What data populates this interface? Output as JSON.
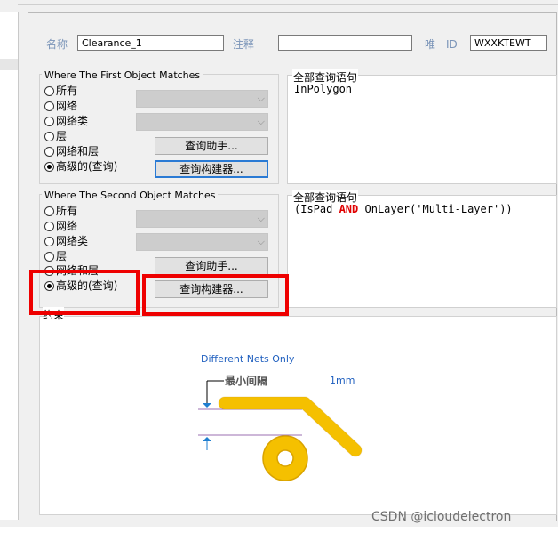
{
  "header": {
    "name_label": "名称",
    "name_value": "Clearance_1",
    "comment_label": "注释",
    "comment_value": "",
    "uid_label": "唯一ID",
    "uid_value": "WXXKTEWT"
  },
  "first_group": {
    "title": "Where The First Object Matches",
    "options": [
      "所有",
      "网络",
      "网络类",
      "层",
      "网络和层",
      "高级的(查询)"
    ],
    "selected_index": 5,
    "helper_button": "查询助手...",
    "builder_button": "查询构建器..."
  },
  "first_query": {
    "title": "全部查询语句",
    "text": "InPolygon"
  },
  "second_group": {
    "title": "Where The Second Object Matches",
    "options": [
      "所有",
      "网络",
      "网络类",
      "层",
      "网络和层",
      "高级的(查询)"
    ],
    "selected_index": 5,
    "helper_button": "查询助手...",
    "builder_button": "查询构建器..."
  },
  "second_query": {
    "title": "全部查询语句",
    "parts": {
      "open": "(IsPad ",
      "and": "AND",
      "rest": " OnLayer('Multi-Layer'))"
    }
  },
  "constraints": {
    "title": "约束",
    "different_nets": "Different Nets Only",
    "min_clearance": "最小间隔",
    "value": "1mm"
  },
  "colors": {
    "keyword": "#e00000",
    "highlight": "#ee0000",
    "copper": "#f5c000",
    "link_blue": "#1f5fbf"
  },
  "watermark": "CSDN @icloudelectron"
}
